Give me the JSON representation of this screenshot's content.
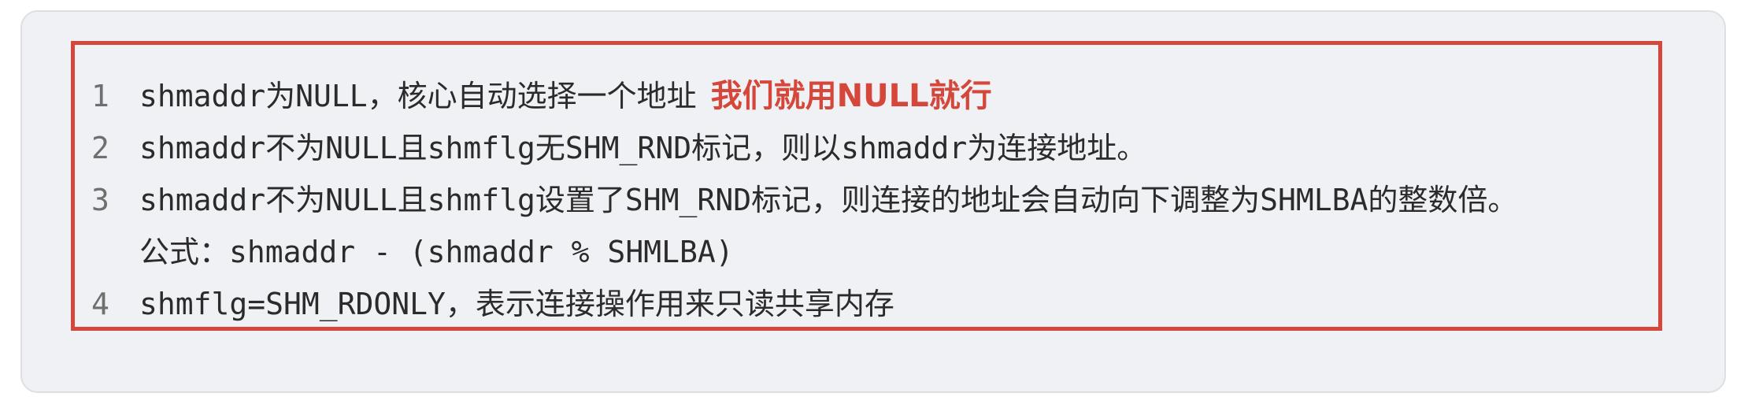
{
  "lines": [
    {
      "num": "1",
      "text": "shmaddr为NULL，核心自动选择一个地址",
      "annotation": "我们就用NULL就行"
    },
    {
      "num": "2",
      "text": "shmaddr不为NULL且shmflg无SHM_RND标记，则以shmaddr为连接地址。"
    },
    {
      "num": "3",
      "text": "shmaddr不为NULL且shmflg设置了SHM_RND标记，则连接的地址会自动向下调整为SHMLBA的整数倍。"
    },
    {
      "num": "",
      "text": "公式：shmaddr - (shmaddr % SHMLBA)"
    },
    {
      "num": "4",
      "text": "shmflg=SHM_RDONLY，表示连接操作用来只读共享内存"
    }
  ],
  "colors": {
    "highlight_border": "#d4473a",
    "annotation": "#d4473a",
    "background": "#f0f1f4"
  }
}
